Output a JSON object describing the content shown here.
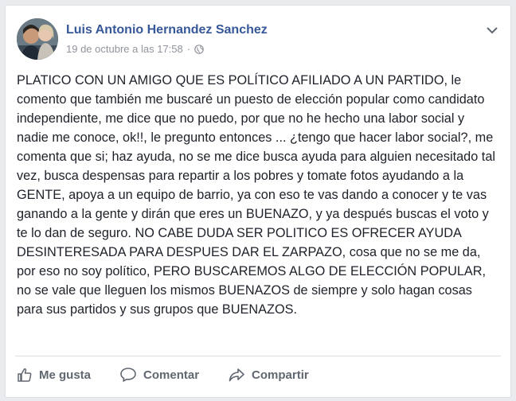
{
  "post": {
    "author": "Luis Antonio Hernandez Sanchez",
    "timestamp": "19 de octubre a las 17:58",
    "separator": "·",
    "privacy_icon": "globe-icon",
    "menu_icon": "chevron-down-icon",
    "text": "PLATICO CON UN AMIGO QUE ES POLÍTICO AFILIADO A UN PARTIDO, le comento que también me buscaré un puesto de elección popular como candidato independiente, me dice que no puedo, por que no he hecho una labor social y nadie me conoce, ok!!, le pregunto entonces ... ¿tengo que hacer labor social?, me comenta que si; haz ayuda, no se me dice busca ayuda para alguien necesitado tal vez, busca despensas para repartir a los pobres y tomate fotos ayudando a la GENTE, apoya a un equipo de barrio, ya con eso te vas dando a conocer y te vas ganando a la gente y dirán que eres un BUENAZO, y ya después buscas el voto y te lo dan de seguro. NO CABE DUDA SER POLITICO ES OFRECER AYUDA DESINTERESADA PARA DESPUES DAR EL ZARPAZO, cosa que no se me da, por eso no soy político, PERO BUSCAREMOS ALGO DE ELECCIÓN POPULAR, no se vale que lleguen los mismos BUENAZOS de siempre y solo hagan cosas para sus partidos y sus grupos que BUENAZOS."
  },
  "actions": {
    "like_label": "Me gusta",
    "comment_label": "Comentar",
    "share_label": "Compartir"
  },
  "colors": {
    "author_link": "#365899",
    "meta_text": "#90949c",
    "body_text": "#1d2129",
    "action_text": "#606770",
    "background": "#e9ebee"
  }
}
